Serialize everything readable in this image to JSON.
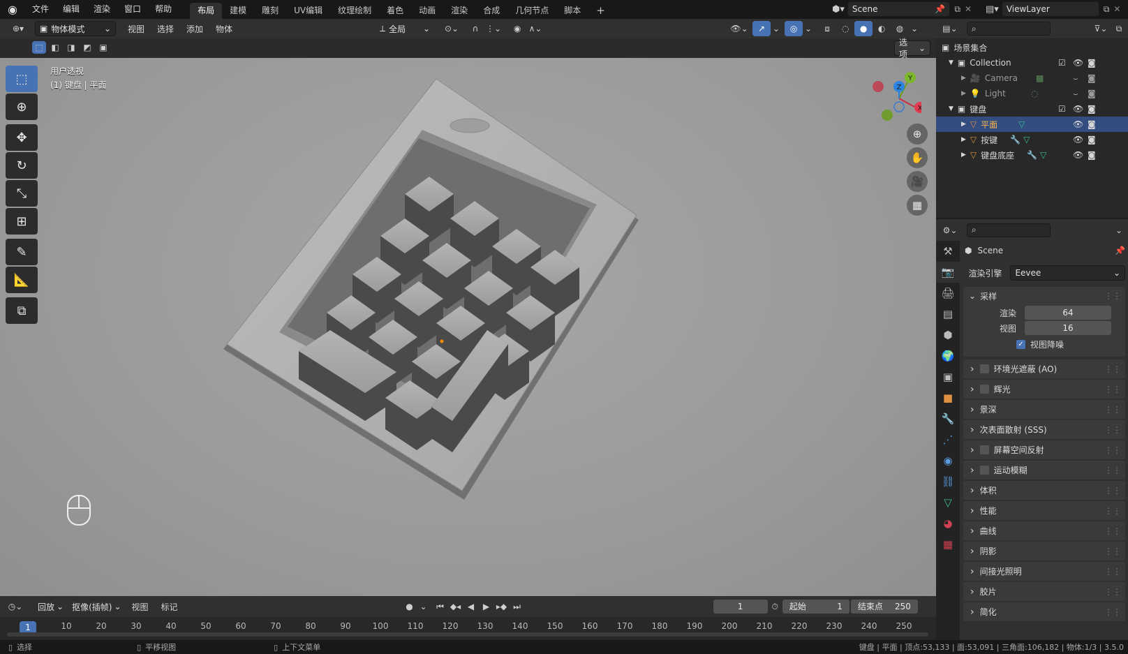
{
  "topbar": {
    "menus": [
      "文件",
      "编辑",
      "渲染",
      "窗口",
      "帮助"
    ],
    "workspaces": [
      "布局",
      "建模",
      "雕刻",
      "UV编辑",
      "纹理绘制",
      "着色",
      "动画",
      "渲染",
      "合成",
      "几何节点",
      "脚本"
    ],
    "active_workspace": "布局",
    "add_tab": "+",
    "scene": "Scene",
    "view_layer": "ViewLayer"
  },
  "viewport_header": {
    "mode": "物体模式",
    "menus": [
      "视图",
      "选择",
      "添加",
      "物体"
    ],
    "transform_orientation": "全局",
    "options": "选项"
  },
  "viewport": {
    "view_name": "用户透视",
    "object_info": "(1) 键盘 | 平面",
    "gizmo_axes": [
      "X",
      "Y",
      "Z"
    ]
  },
  "outliner": {
    "root": "场景集合",
    "items": [
      {
        "label": "Collection",
        "kind": "collection"
      },
      {
        "label": "Camera",
        "kind": "camera"
      },
      {
        "label": "Light",
        "kind": "light"
      },
      {
        "label": "键盘",
        "kind": "collection"
      },
      {
        "label": "平面",
        "kind": "mesh",
        "selected": true
      },
      {
        "label": "按键",
        "kind": "mesh"
      },
      {
        "label": "键盘底座",
        "kind": "mesh"
      }
    ]
  },
  "properties": {
    "scene_label": "Scene",
    "render_engine_label": "渲染引擎",
    "render_engine": "Eevee",
    "sampling": {
      "title": "采样",
      "render_label": "渲染",
      "render_value": "64",
      "viewport_label": "视图",
      "viewport_value": "16",
      "denoise_label": "视图降噪"
    },
    "panels": [
      {
        "label": "环境光遮蔽 (AO)",
        "has_check": true
      },
      {
        "label": "辉光",
        "has_check": true
      },
      {
        "label": "景深",
        "has_check": false
      },
      {
        "label": "次表面散射 (SSS)",
        "has_check": false
      },
      {
        "label": "屏幕空间反射",
        "has_check": true
      },
      {
        "label": "运动模糊",
        "has_check": true
      },
      {
        "label": "体积",
        "has_check": false
      },
      {
        "label": "性能",
        "has_check": false
      },
      {
        "label": "曲线",
        "has_check": false
      },
      {
        "label": "阴影",
        "has_check": false
      },
      {
        "label": "间接光照明",
        "has_check": false
      },
      {
        "label": "胶片",
        "has_check": false
      },
      {
        "label": "简化",
        "has_check": false
      }
    ]
  },
  "timeline": {
    "playback": "回放",
    "keying": "抠像(插帧)",
    "view": "视图",
    "marker": "标记",
    "current_frame": "1",
    "start_label": "起始",
    "start": "1",
    "end_label": "结束点",
    "end": "250",
    "ruler_labels": [
      "1",
      "10",
      "20",
      "30",
      "40",
      "50",
      "60",
      "70",
      "80",
      "90",
      "100",
      "110",
      "120",
      "130",
      "140",
      "150",
      "160",
      "170",
      "180",
      "190",
      "200",
      "210",
      "220",
      "230",
      "240",
      "250"
    ]
  },
  "statusbar": {
    "select": "选择",
    "pan": "平移视图",
    "context": "上下文菜单",
    "stats": "键盘 | 平面 | 顶点:53,133 | 面:53,091 | 三角面:106,182 | 物体:1/3 | 3.5.0"
  }
}
